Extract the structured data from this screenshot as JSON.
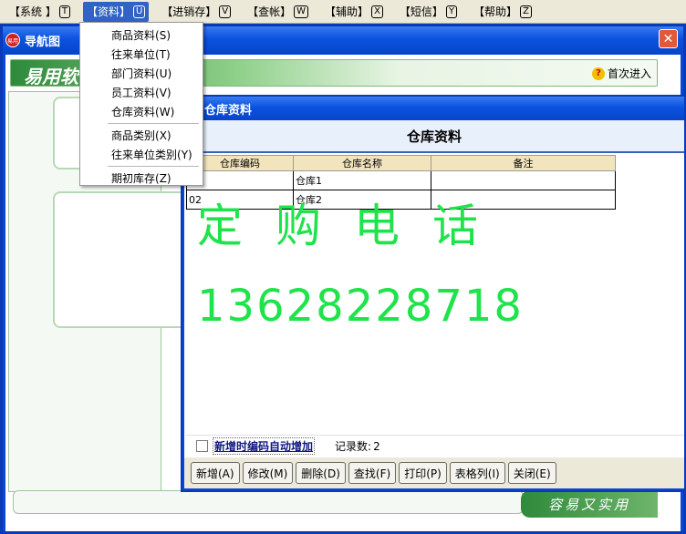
{
  "menubar": {
    "items": [
      {
        "label": "【系统 】",
        "key": "T"
      },
      {
        "label": "【资料】",
        "key": "U"
      },
      {
        "label": "【进销存】",
        "key": "V"
      },
      {
        "label": "【查帐】",
        "key": "W"
      },
      {
        "label": "【辅助】",
        "key": "X"
      },
      {
        "label": "【短信】",
        "key": "Y"
      },
      {
        "label": "【帮助】",
        "key": "Z"
      }
    ]
  },
  "data_menu": {
    "items": [
      {
        "label": "商品资料",
        "key": "(S)"
      },
      {
        "label": "往来单位",
        "key": "(T)"
      },
      {
        "label": "部门资料",
        "key": "(U)"
      },
      {
        "label": "员工资料",
        "key": "(V)"
      },
      {
        "label": "仓库资料",
        "key": "(W)"
      },
      {
        "label": "商品类别",
        "key": "(X)"
      },
      {
        "label": "往来单位类别",
        "key": "(Y)"
      },
      {
        "label": "期初库存",
        "key": "(Z)"
      }
    ]
  },
  "nav_window": {
    "title": "导航图",
    "icon_text": "易用",
    "banner_text": "易用软",
    "first_login": "首次进入",
    "footer_logo": "容易又实用"
  },
  "warehouse_window": {
    "title": "仓库资料",
    "heading": "仓库资料",
    "columns": [
      "仓库编码",
      "仓库名称",
      "备注"
    ],
    "rows": [
      {
        "code": "",
        "name": "仓库1",
        "note": ""
      },
      {
        "code": "02",
        "name": "仓库2",
        "note": ""
      }
    ],
    "auto_increment_label": "新增时编码自动增加",
    "record_count_label": "记录数:",
    "record_count": "2",
    "buttons": {
      "add": "新增(A)",
      "edit": "修改(M)",
      "delete": "删除(D)",
      "find": "查找(F)",
      "print": "打印(P)",
      "table_format": "表格列(I)",
      "close": "关闭(E)"
    }
  },
  "watermark": {
    "label": "定购电话",
    "phone": "13628228718"
  },
  "colors": {
    "title_blue": "#0a52e0",
    "watermark_green": "#1ee34a",
    "grid_header": "#f2e4bd"
  }
}
